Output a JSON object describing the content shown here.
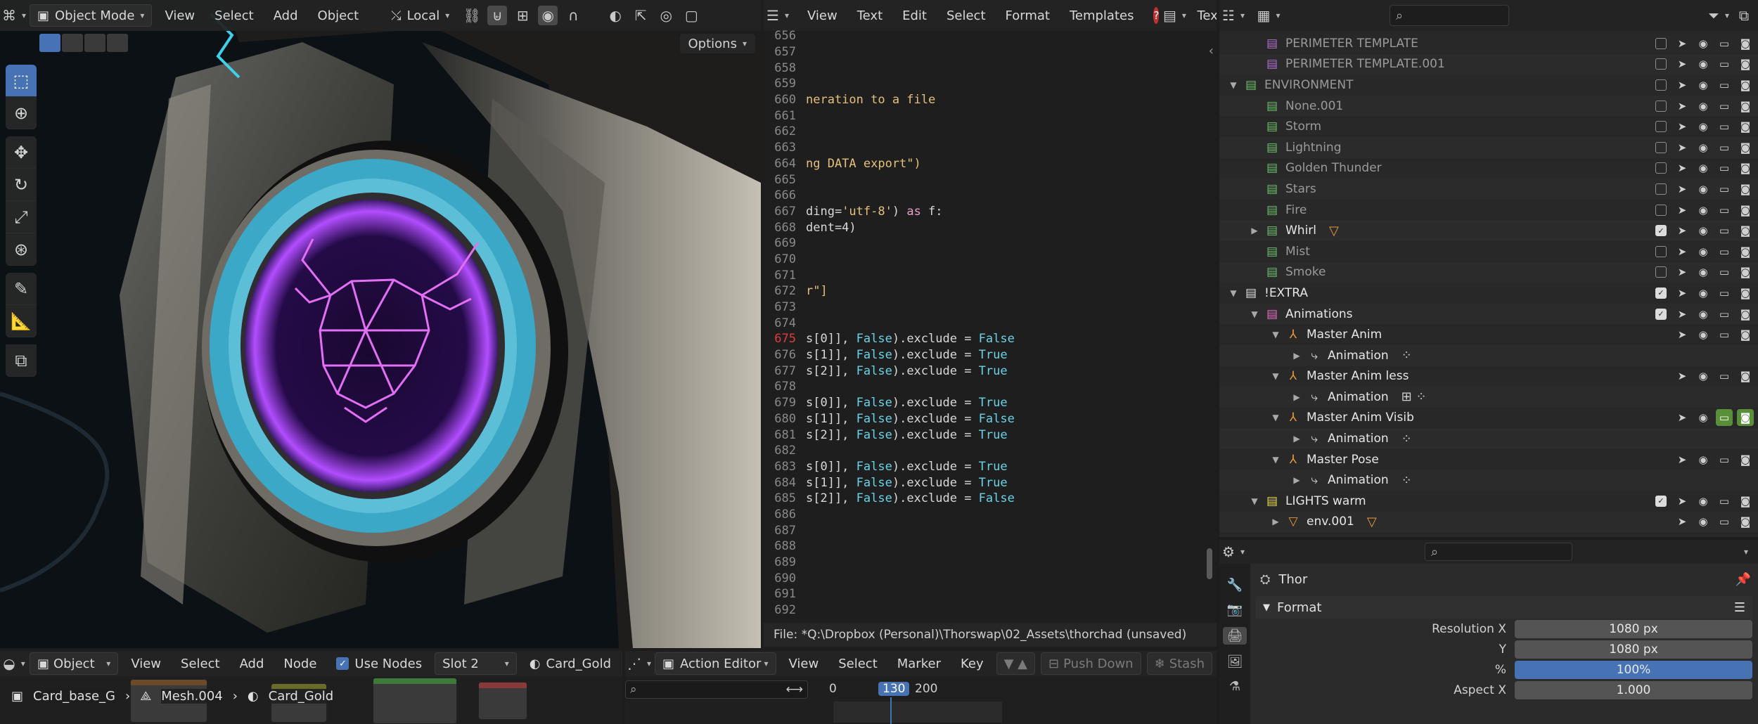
{
  "viewport": {
    "mode": "Object Mode",
    "menu": [
      "View",
      "Select",
      "Add",
      "Object"
    ],
    "orientation": "Local",
    "options_label": "Options"
  },
  "text_editor": {
    "menu": [
      "View",
      "Text",
      "Edit",
      "Select",
      "Format",
      "Templates"
    ],
    "text_label": "Text",
    "current_line": "675",
    "lines": [
      {
        "n": "656",
        "code": ""
      },
      {
        "n": "657",
        "code": ""
      },
      {
        "n": "658",
        "code": ""
      },
      {
        "n": "659",
        "code": ""
      },
      {
        "n": "660",
        "code": "neration to a file"
      },
      {
        "n": "661",
        "code": ""
      },
      {
        "n": "662",
        "code": ""
      },
      {
        "n": "663",
        "code": ""
      },
      {
        "n": "664",
        "code": "ng DATA export\")"
      },
      {
        "n": "665",
        "code": ""
      },
      {
        "n": "666",
        "code": ""
      },
      {
        "n": "667",
        "code": "ding='utf-8') as f:"
      },
      {
        "n": "668",
        "code": "dent=4)"
      },
      {
        "n": "669",
        "code": ""
      },
      {
        "n": "670",
        "code": ""
      },
      {
        "n": "671",
        "code": ""
      },
      {
        "n": "672",
        "code": "r\"]"
      },
      {
        "n": "673",
        "code": ""
      },
      {
        "n": "674",
        "code": ""
      },
      {
        "n": "675",
        "code": "s[0]], False).exclude = False"
      },
      {
        "n": "676",
        "code": "s[1]], False).exclude = True"
      },
      {
        "n": "677",
        "code": "s[2]], False).exclude = True"
      },
      {
        "n": "678",
        "code": ""
      },
      {
        "n": "679",
        "code": "s[0]], False).exclude = True"
      },
      {
        "n": "680",
        "code": "s[1]], False).exclude = False"
      },
      {
        "n": "681",
        "code": "s[2]], False).exclude = True"
      },
      {
        "n": "682",
        "code": ""
      },
      {
        "n": "683",
        "code": "s[0]], False).exclude = True"
      },
      {
        "n": "684",
        "code": "s[1]], False).exclude = True"
      },
      {
        "n": "685",
        "code": "s[2]], False).exclude = False"
      },
      {
        "n": "686",
        "code": ""
      },
      {
        "n": "687",
        "code": ""
      },
      {
        "n": "688",
        "code": ""
      },
      {
        "n": "689",
        "code": ""
      },
      {
        "n": "690",
        "code": ""
      },
      {
        "n": "691",
        "code": ""
      },
      {
        "n": "692",
        "code": ""
      }
    ],
    "status": "File: *Q:\\Dropbox (Personal)\\Thorswap\\02_Assets\\thorchad (unsaved)"
  },
  "outliner": {
    "rows": [
      {
        "label": "PERIMETER TEMPLATE",
        "indent": 2,
        "tri": "",
        "icon": "collection",
        "color": "#b06fd0",
        "dim": true,
        "checkbox": "off",
        "extra": ""
      },
      {
        "label": "PERIMETER TEMPLATE.001",
        "indent": 2,
        "tri": "",
        "icon": "collection",
        "color": "#b06fd0",
        "dim": true,
        "checkbox": "off",
        "extra": ""
      },
      {
        "label": "ENVIRONMENT",
        "indent": 1,
        "tri": "▼",
        "icon": "collection",
        "color": "#6dbe6a",
        "dim": true,
        "checkbox": "off",
        "extra": ""
      },
      {
        "label": "None.001",
        "indent": 2,
        "tri": "",
        "icon": "collection",
        "color": "#6dbe6a",
        "dim": true,
        "checkbox": "off",
        "extra": ""
      },
      {
        "label": "Storm",
        "indent": 2,
        "tri": "",
        "icon": "collection",
        "color": "#6dbe6a",
        "dim": true,
        "checkbox": "off",
        "extra": ""
      },
      {
        "label": "Lightning",
        "indent": 2,
        "tri": "",
        "icon": "collection",
        "color": "#6dbe6a",
        "dim": true,
        "checkbox": "off",
        "extra": ""
      },
      {
        "label": "Golden Thunder",
        "indent": 2,
        "tri": "",
        "icon": "collection",
        "color": "#6dbe6a",
        "dim": true,
        "checkbox": "off",
        "extra": ""
      },
      {
        "label": "Stars",
        "indent": 2,
        "tri": "",
        "icon": "collection",
        "color": "#6dbe6a",
        "dim": true,
        "checkbox": "off",
        "extra": ""
      },
      {
        "label": "Fire",
        "indent": 2,
        "tri": "",
        "icon": "collection",
        "color": "#6dbe6a",
        "dim": true,
        "checkbox": "off",
        "extra": ""
      },
      {
        "label": "Whirl",
        "indent": 2,
        "tri": "▶",
        "icon": "collection",
        "color": "#6dbe6a",
        "dim": false,
        "checkbox": "on",
        "extra": "▽"
      },
      {
        "label": "Mist",
        "indent": 2,
        "tri": "",
        "icon": "collection",
        "color": "#6dbe6a",
        "dim": true,
        "checkbox": "off",
        "extra": ""
      },
      {
        "label": "Smoke",
        "indent": 2,
        "tri": "",
        "icon": "collection",
        "color": "#6dbe6a",
        "dim": true,
        "checkbox": "off",
        "extra": ""
      },
      {
        "label": "!EXTRA",
        "indent": 1,
        "tri": "▼",
        "icon": "collection",
        "color": "#e0e0e0",
        "dim": false,
        "checkbox": "on",
        "extra": ""
      },
      {
        "label": "Animations",
        "indent": 2,
        "tri": "▼",
        "icon": "collection",
        "color": "#e36fc4",
        "dim": false,
        "checkbox": "on",
        "extra": ""
      },
      {
        "label": "Master Anim",
        "indent": 3,
        "tri": "▼",
        "icon": "armature",
        "color": "#e89a3c",
        "dim": false,
        "checkbox": "none",
        "extra": ""
      },
      {
        "label": "Animation",
        "indent": 4,
        "tri": "▶",
        "icon": "action",
        "color": "#cfcfcf",
        "dim": false,
        "checkbox": "none",
        "extra": "⁘"
      },
      {
        "label": "Master Anim less",
        "indent": 3,
        "tri": "▼",
        "icon": "armature",
        "color": "#e89a3c",
        "dim": false,
        "checkbox": "none",
        "extra": ""
      },
      {
        "label": "Animation",
        "indent": 4,
        "tri": "▶",
        "icon": "action",
        "color": "#cfcfcf",
        "dim": false,
        "checkbox": "none",
        "extra": "⊞ ⁘"
      },
      {
        "label": "Master Anim Visib",
        "indent": 3,
        "tri": "▼",
        "icon": "armature",
        "color": "#e89a3c",
        "dim": false,
        "checkbox": "none",
        "extra": "",
        "green": true
      },
      {
        "label": "Animation",
        "indent": 4,
        "tri": "▶",
        "icon": "action",
        "color": "#cfcfcf",
        "dim": false,
        "checkbox": "none",
        "extra": "⁘"
      },
      {
        "label": "Master Pose",
        "indent": 3,
        "tri": "▼",
        "icon": "armature",
        "color": "#e89a3c",
        "dim": false,
        "checkbox": "none",
        "extra": ""
      },
      {
        "label": "Animation",
        "indent": 4,
        "tri": "▶",
        "icon": "action",
        "color": "#cfcfcf",
        "dim": false,
        "checkbox": "none",
        "extra": "⁘"
      },
      {
        "label": "LIGHTS warm",
        "indent": 2,
        "tri": "▼",
        "icon": "collection",
        "color": "#e6d84a",
        "dim": false,
        "checkbox": "on",
        "extra": ""
      },
      {
        "label": "env.001",
        "indent": 3,
        "tri": "▶",
        "icon": "empty",
        "color": "#e89a3c",
        "dim": false,
        "checkbox": "none",
        "extra": "▽"
      }
    ]
  },
  "properties": {
    "object_name": "Thor",
    "section": "Format",
    "fields": [
      {
        "label": "Resolution X",
        "value": "1080 px",
        "blue": false
      },
      {
        "label": "Y",
        "value": "1080 px",
        "blue": false
      },
      {
        "label": "%",
        "value": "100%",
        "blue": true
      },
      {
        "label": "Aspect X",
        "value": "1.000",
        "blue": false
      }
    ]
  },
  "node_editor": {
    "mode": "Object",
    "menu": [
      "View",
      "Select",
      "Add",
      "Node"
    ],
    "use_nodes": "Use Nodes",
    "slot": "Slot 2",
    "material": "Card_Gold",
    "crumbs": [
      "Card_base_G",
      "Mesh.004",
      "Card_Gold"
    ]
  },
  "action_editor": {
    "mode": "Action Editor",
    "menu": [
      "View",
      "Select",
      "Marker",
      "Key"
    ],
    "push_down": "Push Down",
    "stash": "Stash",
    "frames": [
      "0",
      "130",
      "200"
    ]
  },
  "colors": {
    "accent": "#4772b3",
    "bool": "#6ad3e8",
    "string": "#e6c07b",
    "keyword": "#e6a0c8"
  }
}
